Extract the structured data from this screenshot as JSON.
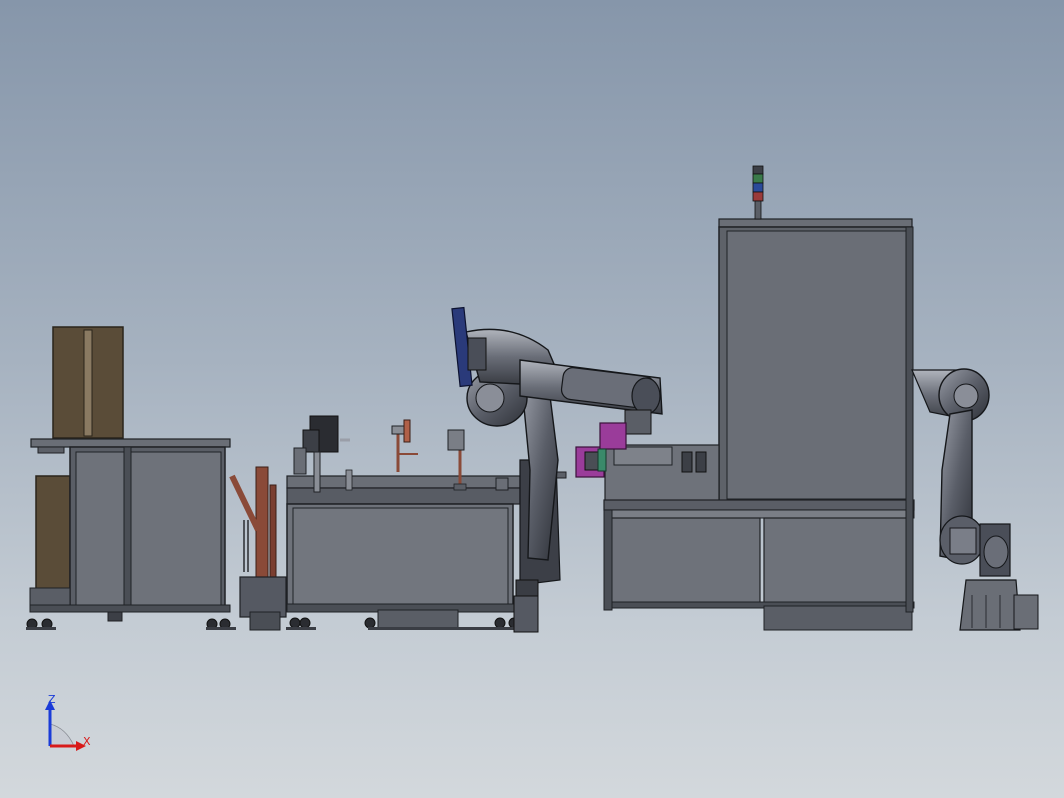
{
  "app": {
    "view": "cad-3d-assembly-viewport"
  },
  "triad": {
    "z_label": "Z",
    "x_label": "X",
    "z_color": "#1a3bd8",
    "x_color": "#d81a1a"
  },
  "colors": {
    "background_top": "#8696aa",
    "background_bottom": "#d3d8dc",
    "frame_dark": "#4a4e55",
    "panel_gray": "#7c8088",
    "robot_dark": "#3c3f47",
    "robot_light": "#9a9ea8",
    "carton_brown": "#5a4c38",
    "rust": "#8a4a38",
    "magenta": "#9a3c9a",
    "navy_fixture": "#2a3a7a"
  },
  "scene": {
    "objects": [
      "cardboard-cartons",
      "left-conveyor-cabinet",
      "rust-stand",
      "workbench-with-fixtures",
      "center-robot-arm",
      "right-machine-enclosure",
      "right-robot-arm",
      "signal-tower"
    ]
  }
}
